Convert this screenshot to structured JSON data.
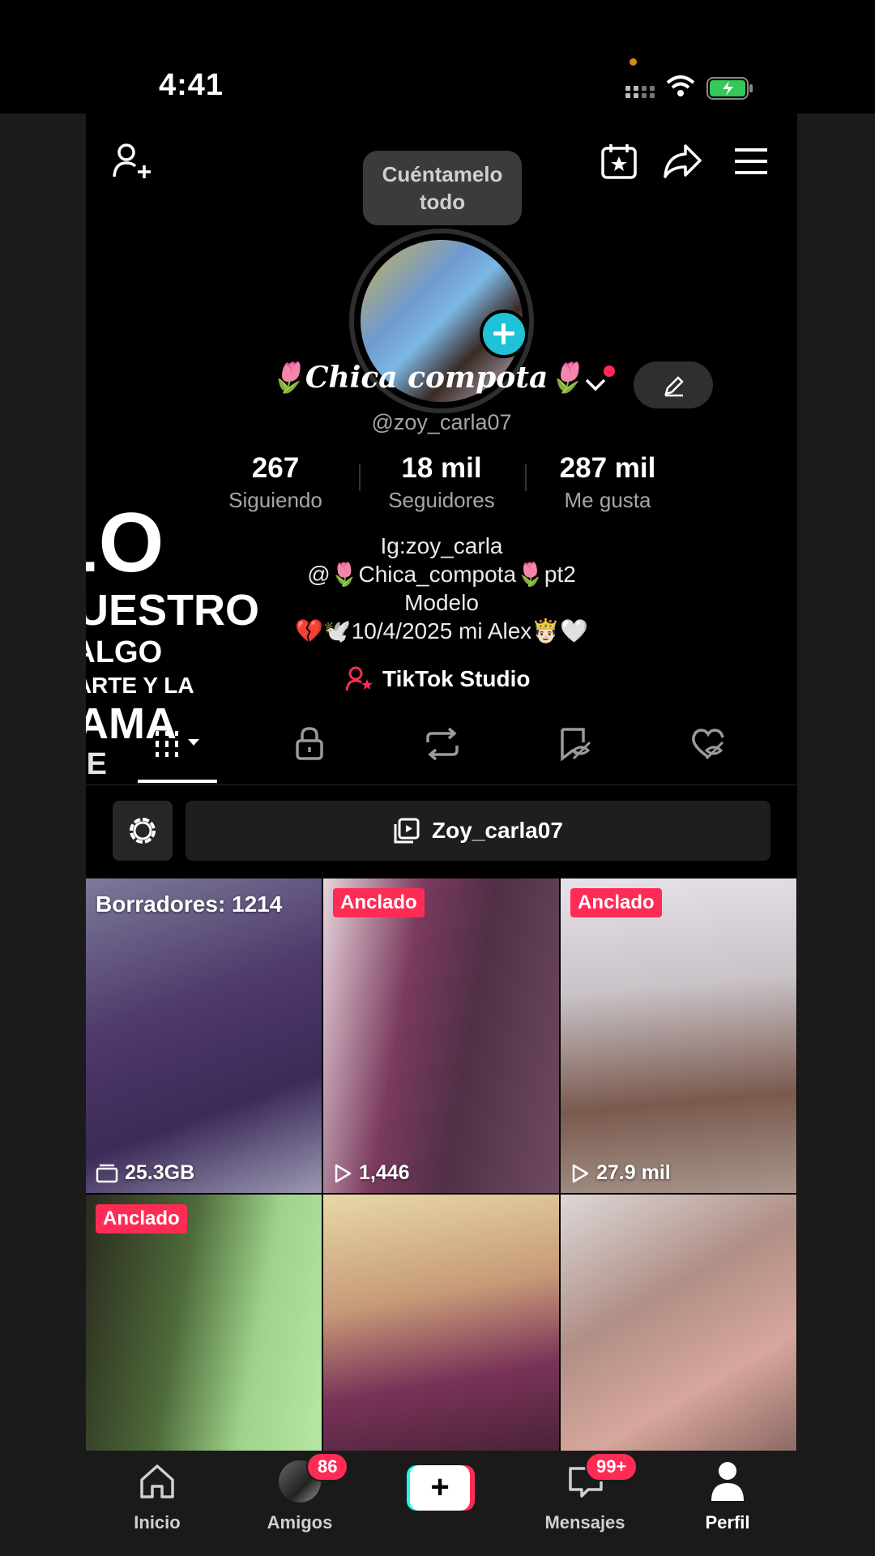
{
  "status_bar": {
    "time": "4:41"
  },
  "header": {
    "tooltip": "Cuéntamelo todo"
  },
  "profile": {
    "display_name": "🌷𝑪𝒉𝒊𝒄𝒂 𝒄𝒐𝒎𝒑𝒐𝒕𝒂🌷",
    "handle": "@zoy_carla07",
    "stats": [
      {
        "value": "267",
        "label": "Siguiendo"
      },
      {
        "value": "18 mil",
        "label": "Seguidores"
      },
      {
        "value": "287 mil",
        "label": "Me gusta"
      }
    ],
    "bio": [
      "Ig:zoy_carla",
      "@🌷Chica_compota🌷pt2",
      "Modelo",
      "💔🕊️10/4/2025 mi Alex🤴🏻🤍"
    ],
    "studio_label": "TikTok Studio"
  },
  "overlay_text": [
    "LO",
    "NUESTRO",
    "E'ALGO",
    "APARTE Y LA",
    "CAMA",
    "FUE"
  ],
  "tabs": [
    "videos-tab",
    "private-tab",
    "reposts-tab",
    "favorites-tab",
    "liked-tab"
  ],
  "playlist": {
    "label": "Zoy_carla07"
  },
  "grid": {
    "tiles": [
      {
        "draft": "Borradores: 1214",
        "count": "25.3GB",
        "count_icon": "folder-icon",
        "bg": "linear-gradient(160deg,#7d7a99 0%,#4e3a6b 40%,#3c2a58 70%,#9b98b3 100%)"
      },
      {
        "badge": "Anclado",
        "count": "1,446",
        "count_icon": "play-icon",
        "bg": "linear-gradient(100deg,#e7d4db 0%,#7a3a5e 35%,#503046 60%,#6e4a60 100%)"
      },
      {
        "badge": "Anclado",
        "count": "27.9 mil",
        "count_icon": "play-icon",
        "bg": "linear-gradient(175deg,#e6e2ea 0%,#c9c2c7 35%,#7a5a4e 70%,#a7958c 100%)"
      },
      {
        "badge": "Anclado",
        "bg": "linear-gradient(100deg,#2a2a1e 0%,#4e6a3a 40%,#9ed28a 70%,#b9e6a4 100%)"
      },
      {
        "bg": "linear-gradient(170deg,#e8d8a8 0%,#c79a78 40%,#7a3358 70%,#4a2238 100%)"
      },
      {
        "bg": "linear-gradient(150deg,#ddd8d8 0%,#b08f86 40%,#d7a69c 70%,#8c6a64 100%)"
      }
    ]
  },
  "bottom_nav": {
    "items": [
      {
        "label": "Inicio"
      },
      {
        "label": "Amigos",
        "badge": "86"
      },
      {
        "label": ""
      },
      {
        "label": "Mensajes",
        "badge": "99+"
      },
      {
        "label": "Perfil"
      }
    ],
    "create_label": "+"
  }
}
